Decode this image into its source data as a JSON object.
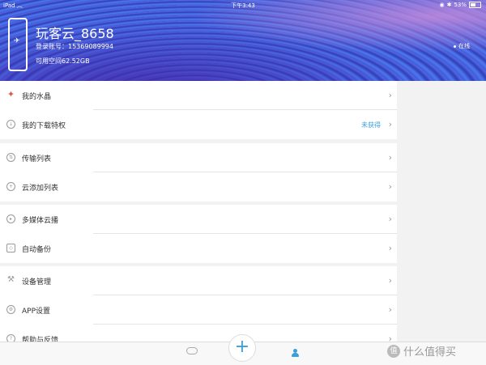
{
  "status_bar": {
    "device": "iPad",
    "time": "下午3:43",
    "battery": "53%"
  },
  "profile": {
    "username": "玩客云_8658",
    "account": "登录账号：15369089994",
    "storage": "可用空间62.52GB",
    "status": "在线"
  },
  "groups": [
    {
      "items": [
        {
          "label": "我的水晶",
          "icon": "crystal-icon"
        },
        {
          "label": "我的下载特权",
          "icon": "download-privilege-icon",
          "badge": "未获得"
        }
      ]
    },
    {
      "items": [
        {
          "label": "传输列表",
          "icon": "transfer-icon"
        },
        {
          "label": "云添加列表",
          "icon": "cloud-add-icon"
        }
      ]
    },
    {
      "items": [
        {
          "label": "多媒体云播",
          "icon": "cloud-play-icon"
        },
        {
          "label": "自动备份",
          "icon": "backup-icon"
        }
      ]
    },
    {
      "items": [
        {
          "label": "设备管理",
          "icon": "wrench-icon"
        },
        {
          "label": "APP设置",
          "icon": "settings-icon"
        },
        {
          "label": "帮助与反馈",
          "icon": "help-icon"
        }
      ]
    }
  ],
  "watermark": {
    "text": "什么值得买",
    "logo": "值"
  },
  "colors": {
    "accent": "#3aa0d8",
    "crystal": "#e2574c"
  }
}
